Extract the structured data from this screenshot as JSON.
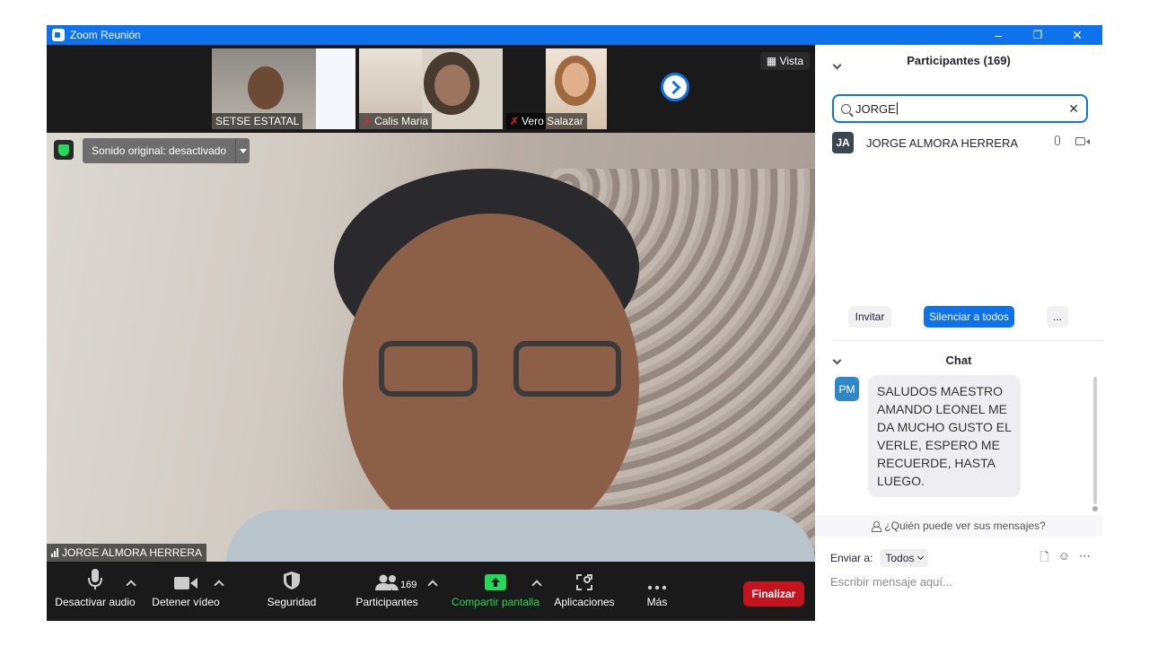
{
  "window": {
    "title": "Zoom Reunión",
    "controls": [
      "–",
      "❐",
      "✕"
    ]
  },
  "gallery": {
    "thumbnails": [
      {
        "name": "SETSE ESTATAL",
        "muted": false
      },
      {
        "name": "Calis Maria",
        "muted": true
      },
      {
        "name": "Vero Salazar",
        "muted": true
      }
    ],
    "view_label": "Vista"
  },
  "main_video": {
    "audio_label": "Sonido original: desactivado",
    "speaker_name": "JORGE ALMORA HERRERA"
  },
  "toolbar": {
    "audio": "Desactivar audio",
    "video": "Detener vídeo",
    "security": "Seguridad",
    "participants": "Participantes",
    "participants_count": "169",
    "share": "Compartir pantalla",
    "apps": "Aplicaciones",
    "more": "Más",
    "end": "Finalizar"
  },
  "participants_panel": {
    "title": "Participantes (169)",
    "search_value": "JORGE",
    "results": [
      {
        "initials": "JA",
        "name": "JORGE ALMORA HERRERA"
      }
    ],
    "invite": "Invitar",
    "mute_all": "Silenciar a todos",
    "more": "..."
  },
  "chat": {
    "title": "Chat",
    "messages": [
      {
        "initials": "PM",
        "text": "SALUDOS MAESTRO AMANDO LEONEL ME DA MUCHO GUSTO EL VERLE, ESPERO ME RECUERDE, HASTA LUEGO."
      }
    ],
    "who_can_see": "¿Quién puede ver sus mensajes?",
    "send_to_label": "Enviar a:",
    "send_to_value": "Todos",
    "input_placeholder": "Escribir mensaje aquí..."
  },
  "colors": {
    "brand_blue": "#0e72ed",
    "end_red": "#c4141f",
    "share_green": "#23d959",
    "toolbar_bg": "#1a1a1a"
  }
}
